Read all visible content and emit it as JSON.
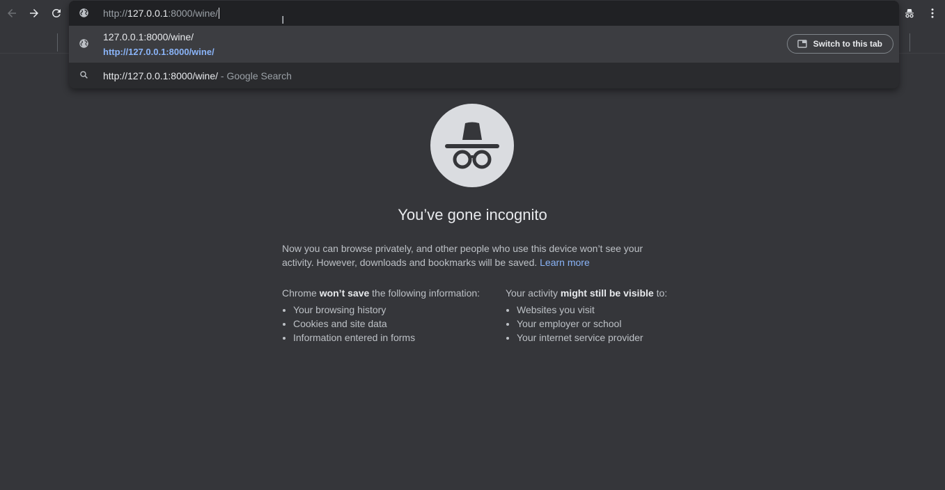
{
  "omnibox": {
    "url_scheme": "http://",
    "url_host": "127.0.0.1",
    "url_rest": ":8000/wine/"
  },
  "suggestions": [
    {
      "title": "127.0.0.1:8000/wine/",
      "url": "http://127.0.0.1:8000/wine/",
      "action_label": "Switch to this tab",
      "icon": "globe-icon"
    },
    {
      "query": "http://127.0.0.1:8000/wine/",
      "suffix": "- Google Search",
      "icon": "search-icon"
    }
  ],
  "incognito": {
    "heading": "You’ve gone incognito",
    "intro": "Now you can browse privately, and other people who use this device won’t see your activity. However, downloads and bookmarks will be saved.",
    "learn_more": "Learn more",
    "left_col": {
      "prefix": "Chrome",
      "bold": "won’t save",
      "suffix": "the following information:",
      "items": [
        "Your browsing history",
        "Cookies and site data",
        "Information entered in forms"
      ]
    },
    "right_col": {
      "prefix": "Your activity",
      "bold": "might still be visible",
      "suffix": "to:",
      "items": [
        "Websites you visit",
        "Your employer or school",
        "Your internet service provider"
      ]
    }
  },
  "colors": {
    "background": "#35363a",
    "link": "#8ab4f8",
    "dropdown": "#202124"
  }
}
